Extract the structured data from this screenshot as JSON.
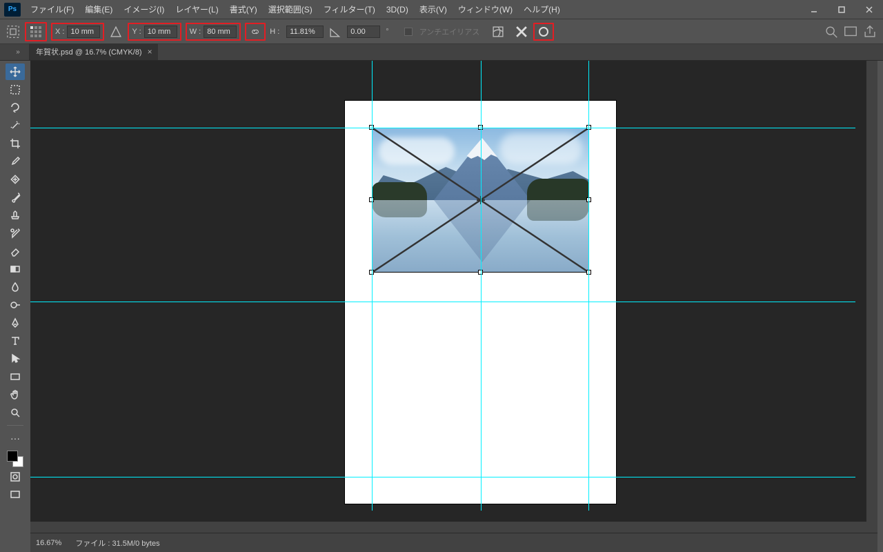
{
  "menu": {
    "file": "ファイル(F)",
    "edit": "編集(E)",
    "image": "イメージ(I)",
    "layer": "レイヤー(L)",
    "type": "書式(Y)",
    "select": "選択範囲(S)",
    "filter": "フィルター(T)",
    "threed": "3D(D)",
    "view": "表示(V)",
    "window": "ウィンドウ(W)",
    "help": "ヘルプ(H)"
  },
  "options": {
    "x_label": "X :",
    "x_value": "10 mm",
    "y_label": "Y :",
    "y_value": "10 mm",
    "w_label": "W :",
    "w_value": "80 mm",
    "h_label": "H :",
    "h_value": "11.81%",
    "angle_value": "0.00",
    "angle_unit": "°",
    "antialias": "アンチエイリアス"
  },
  "tab": {
    "title": "年賀状.psd @ 16.7% (CMYK/8)"
  },
  "status": {
    "zoom": "16.67%",
    "file_label": "ファイル :",
    "file_value": "31.5M/0 bytes"
  },
  "colors": {
    "highlight": "#e31e24",
    "guide": "#00f0ff"
  }
}
